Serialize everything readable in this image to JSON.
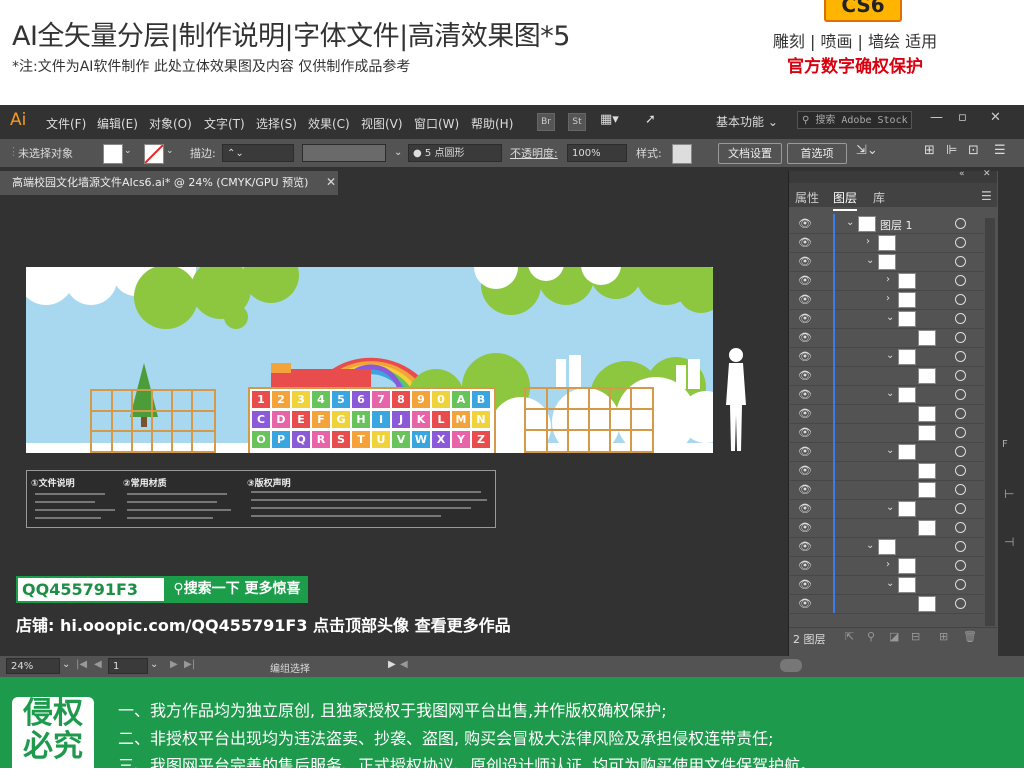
{
  "promo": {
    "title": "AI全矢量分层|制作说明|字体文件|高清效果图*5",
    "note": "*注:文件为AI软件制作 此处立体效果图及内容 仅供制作成品参考",
    "badge": "CS6",
    "usage": "雕刻 | 喷画 | 墙绘 适用",
    "protect": "官方数字确权保护"
  },
  "menubar": {
    "logo": "Ai",
    "items": [
      "文件(F)",
      "编辑(E)",
      "对象(O)",
      "文字(T)",
      "选择(S)",
      "效果(C)",
      "视图(V)",
      "窗口(W)",
      "帮助(H)"
    ],
    "br": "Br",
    "st": "St",
    "workspace": "基本功能",
    "search_placeholder": "搜索 Adobe Stock"
  },
  "controlbar": {
    "no_selection": "未选择对象",
    "stroke_label": "描边:",
    "brush": "5 点圆形",
    "opacity_label": "不透明度:",
    "opacity_value": "100%",
    "style_label": "样式:",
    "doc_setup": "文档设置",
    "prefs": "首选项"
  },
  "doc_tab": {
    "title": "高端校园文化墙源文件AIcs6.ai* @ 24% (CMYK/GPU 预览)"
  },
  "artboard": {
    "letters_row1": [
      "1",
      "2",
      "3",
      "4",
      "5",
      "6",
      "7",
      "8",
      "9",
      "0",
      "A",
      "B"
    ],
    "letters_row2": [
      "C",
      "D",
      "E",
      "F",
      "G",
      "H",
      "I",
      "J",
      "K",
      "L",
      "M",
      "N"
    ],
    "letters_row3": [
      "O",
      "P",
      "Q",
      "R",
      "S",
      "T",
      "U",
      "V",
      "W",
      "X",
      "Y",
      "Z"
    ],
    "letter_colors": [
      "#e84c4c",
      "#f3a33a",
      "#f0d33a",
      "#69c35b",
      "#3aa6e0",
      "#8a5ad8",
      "#e864a8"
    ]
  },
  "notes": {
    "head1": "①文件说明",
    "head2": "②常用材质",
    "head3": "③版权声明"
  },
  "watermark": {
    "qq": "QQ455791F3",
    "search": "搜索一下 更多惊喜",
    "shop": "店铺: hi.ooopic.com/QQ455791F3   点击顶部头像 查看更多作品"
  },
  "statusbar": {
    "zoom": "24%",
    "page": "1",
    "mode": "编组选择"
  },
  "panel": {
    "tabs": [
      "属性",
      "图层",
      "库"
    ],
    "layer1_name": "图层 1",
    "footer_count": "2 图层"
  },
  "footer": {
    "badge": "侵权必究",
    "line1": "一、我方作品均为独立原创, 且独家授权于我图网平台出售,并作版权确权保护;",
    "line2": "二、非授权平台出现均为违法盗卖、抄袭、盗图, 购买会冒极大法律风险及承担侵权连带责任;",
    "line3": "三、我图网平台完善的售后服务、正式授权协议、原创设计师认证, 均可为购买使用文件保驾护航。"
  }
}
